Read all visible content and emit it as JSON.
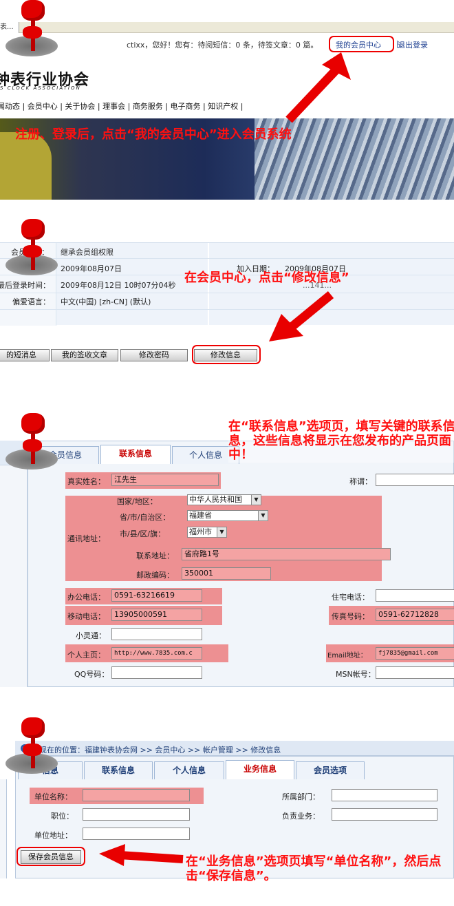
{
  "panel1": {
    "tab_fragment": "表...",
    "welcome": "ctixx，您好！您有：待阅短信：0 条，待签文章：0 篇。",
    "member_center": "我的会员中心",
    "separator": "|",
    "logout": "退出登录",
    "logo_cn": "钟表行业协会",
    "logo_en": "S CLOCK ASSOCIATION",
    "nav": [
      "闻动态",
      "会员中心",
      "关于协会",
      "理事会",
      "商务服务",
      "电子商务",
      "知识产权"
    ],
    "annotation": "注册、登录后，点击“我的会员中心”进入会员系统"
  },
  "panel2": {
    "rows": [
      {
        "label": "会员级别：",
        "value": "继承会员组权限"
      },
      {
        "label": "",
        "value": "2009年08月07日",
        "label2": "加入日期：",
        "value2": "2009年08月07日"
      },
      {
        "label": "最后登录时间：",
        "value": "2009年08月12日 10时07分04秒",
        "label2": "",
        "value2": "...141..."
      },
      {
        "label": "偏爱语言：",
        "value": "中文(中国) [zh-CN] (默认)"
      }
    ],
    "buttons": [
      "的短消息",
      "我的签收文章",
      "修改密码",
      "修改信息"
    ],
    "annotation": "在会员中心，点击“修改信息”"
  },
  "panel3": {
    "tabs": [
      "会员信息",
      "联系信息",
      "个人信息"
    ],
    "annotation": "在“联系信息”选项页，填写关键的联系信息，这些信息将显示在您发布的产品页面中！",
    "fields": {
      "real_name": {
        "label": "真实姓名：",
        "value": "江先生"
      },
      "title": {
        "label": "称谓：",
        "value": ""
      },
      "address_group": {
        "label": "通讯地址："
      },
      "country": {
        "label": "国家/地区：",
        "value": "中华人民共和国"
      },
      "province": {
        "label": "省/市/自治区：",
        "value": "福建省"
      },
      "city": {
        "label": "市/县/区/旗：",
        "value": "福州市"
      },
      "street": {
        "label": "联系地址：",
        "value": "省府路1号"
      },
      "zipcode": {
        "label": "邮政编码：",
        "value": "350001"
      },
      "office_phone": {
        "label": "办公电话：",
        "value": "0591-63216619"
      },
      "home_phone": {
        "label": "住宅电话：",
        "value": ""
      },
      "mobile": {
        "label": "移动电话：",
        "value": "13905000591"
      },
      "fax": {
        "label": "传真号码：",
        "value": "0591-62712828"
      },
      "phs": {
        "label": "小灵通：",
        "value": ""
      },
      "homepage": {
        "label": "个人主页：",
        "value": "http://www.7835.com.c"
      },
      "email": {
        "label": "Email地址：",
        "value": "fj7835@gmail.com"
      },
      "qq": {
        "label": "QQ号码：",
        "value": ""
      },
      "msn": {
        "label": "MSN帐号：",
        "value": ""
      }
    }
  },
  "panel4": {
    "breadcrumb": "您现在的位置：福建钟表协会网 >> 会员中心 >> 帐户管理 >> 修改信息",
    "tabs": [
      "信息",
      "联系信息",
      "个人信息",
      "业务信息",
      "会员选项"
    ],
    "fields": {
      "company": {
        "label": "单位名称：",
        "value": ""
      },
      "department": {
        "label": "所属部门：",
        "value": ""
      },
      "position": {
        "label": "职位：",
        "value": ""
      },
      "responsibility": {
        "label": "负责业务：",
        "value": ""
      },
      "company_address": {
        "label": "单位地址：",
        "value": ""
      }
    },
    "save_button": "保存会员信息",
    "annotation": "在“业务信息”选项页填写“单位名称”，然后点击“保存信息”。"
  }
}
